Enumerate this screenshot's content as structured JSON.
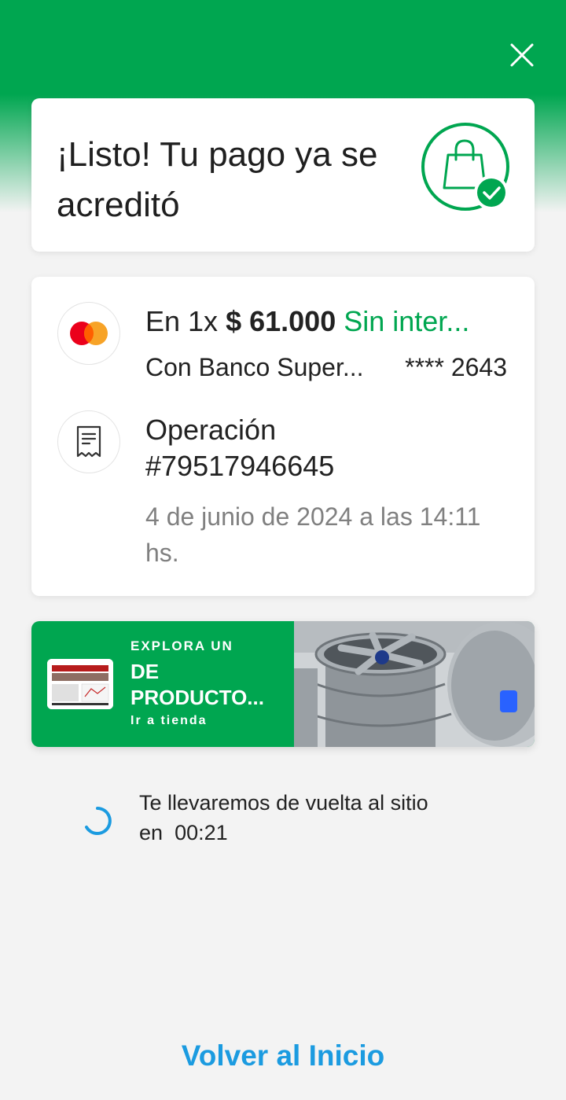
{
  "success": {
    "title": "¡Listo! Tu pago ya se acreditó"
  },
  "payment": {
    "installments": "En 1x",
    "amount": "$ 61.000",
    "interest": "Sin inter...",
    "bank": "Con Banco Super...",
    "card_last": "**** 2643"
  },
  "operation": {
    "label": "Operación",
    "number": "#79517946645",
    "date": "4 de junio de 2024 a las 14:11 hs."
  },
  "promo": {
    "kicker": "EXPLORA UN",
    "title": "DE PRODUCTO...",
    "link": "Ir a tienda"
  },
  "redirect": {
    "text_line1": "Te llevaremos de vuelta al sitio",
    "text_prefix": "en",
    "countdown": "00:21"
  },
  "footer": {
    "back_label": "Volver al Inicio"
  },
  "colors": {
    "brand_green": "#00a650",
    "link_blue": "#1b9be0",
    "mastercard_red": "#eb001b",
    "mastercard_orange": "#f79e1b"
  },
  "icons": [
    "close-icon",
    "shopping-bag-check-icon",
    "mastercard-icon",
    "receipt-icon",
    "spinner-icon"
  ]
}
